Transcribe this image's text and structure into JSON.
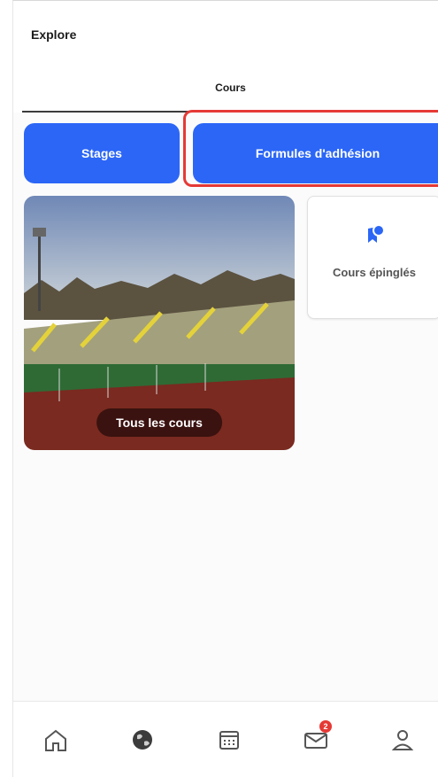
{
  "header": {
    "title": "Explore"
  },
  "tabs": [
    {
      "label": "Cours",
      "active": true
    }
  ],
  "actions": {
    "stages_label": "Stages",
    "formules_label": "Formules d'adhésion"
  },
  "cards": {
    "all_courses_label": "Tous les cours",
    "pinned_label": "Cours épinglés"
  },
  "bottom_nav": {
    "items": [
      {
        "icon": "home-icon"
      },
      {
        "icon": "globe-icon"
      },
      {
        "icon": "calendar-icon"
      },
      {
        "icon": "mail-icon",
        "badge": "2"
      },
      {
        "icon": "profile-icon"
      }
    ]
  },
  "colors": {
    "accent": "#2b66f6",
    "highlight": "#e53935",
    "badge": "#e53935"
  }
}
